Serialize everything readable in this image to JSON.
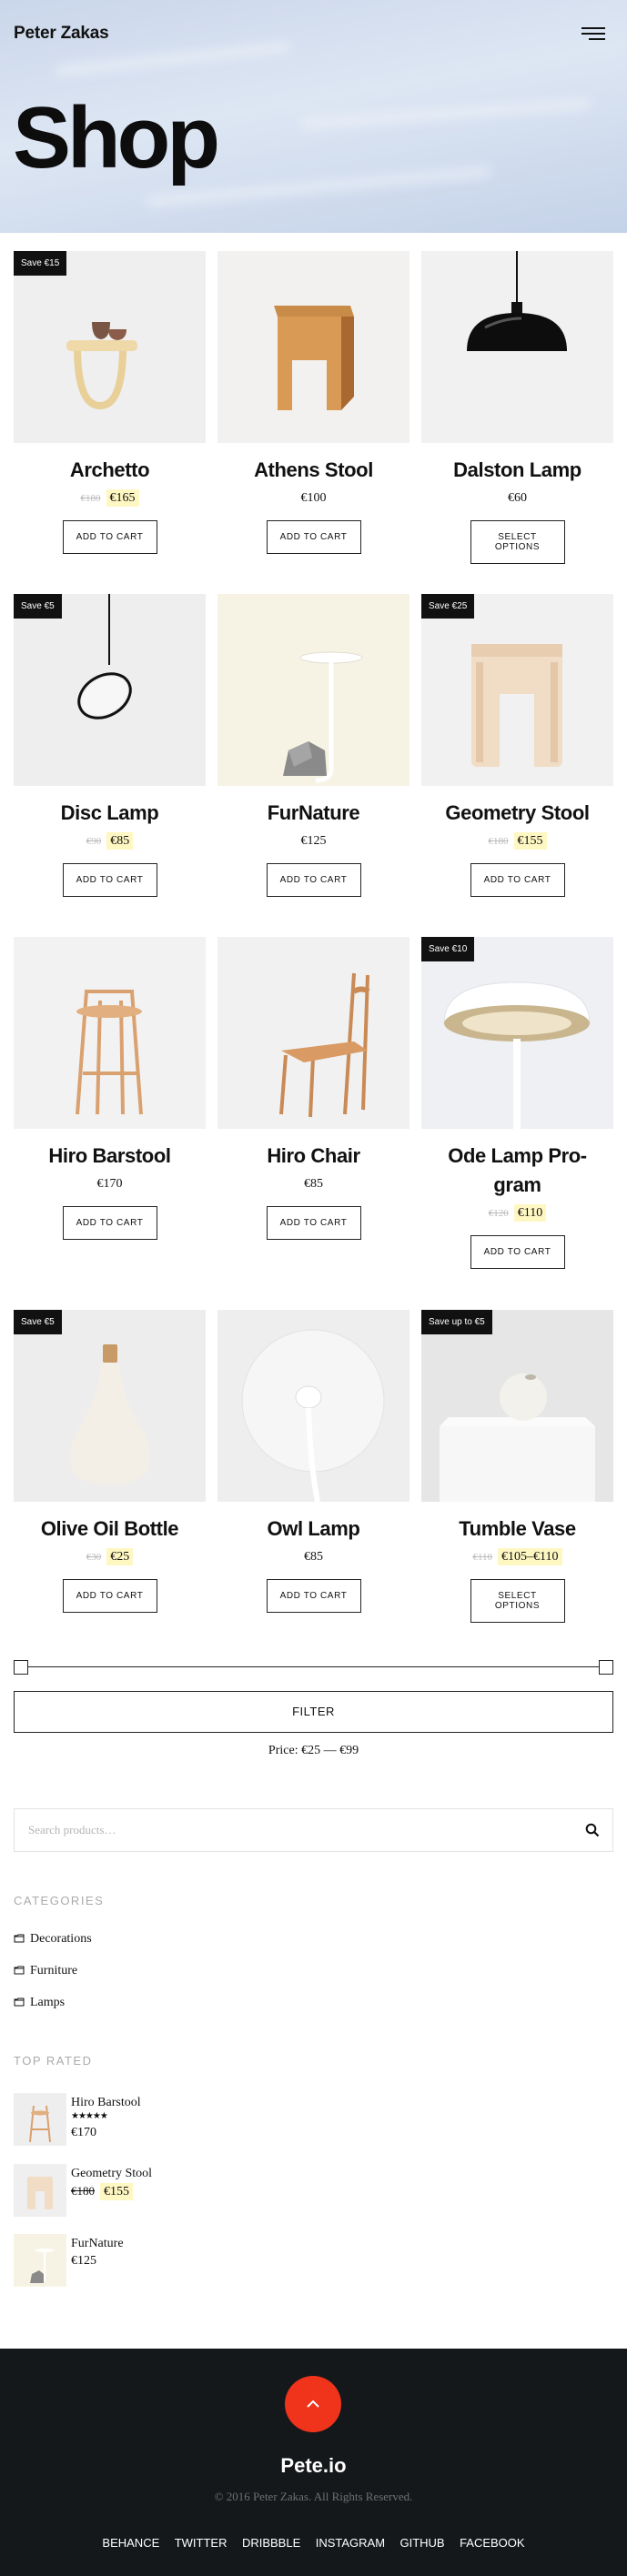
{
  "header": {
    "brand": "Peter Zakas",
    "title": "Shop"
  },
  "products": [
    {
      "name": "Archetto",
      "badge": "Save €15",
      "old_price": "€180",
      "price": "€165",
      "button": "ADD TO CART"
    },
    {
      "name": "Athens Stool",
      "badge": "",
      "old_price": "",
      "price": "€100",
      "button": "ADD TO CART"
    },
    {
      "name": "Dalston Lamp",
      "badge": "",
      "old_price": "",
      "price": "€60",
      "button": "SELECT OPTIONS"
    },
    {
      "name": "Disc Lamp",
      "badge": "Save €5",
      "old_price": "€90",
      "price": "€85",
      "button": "ADD TO CART"
    },
    {
      "name": "FurNature",
      "badge": "",
      "old_price": "",
      "price": "€125",
      "button": "ADD TO CART"
    },
    {
      "name": "Geometry Stool",
      "badge": "Save €25",
      "old_price": "€180",
      "price": "€155",
      "button": "ADD TO CART"
    },
    {
      "name": "Hiro Barstool",
      "badge": "",
      "old_price": "",
      "price": "€170",
      "button": "ADD TO CART"
    },
    {
      "name": "Hiro Chair",
      "badge": "",
      "old_price": "",
      "price": "€85",
      "button": "ADD TO CART"
    },
    {
      "name_line1": "Ode Lamp Pro-",
      "name_line2": "gram",
      "badge": "Save €10",
      "old_price": "€120",
      "price": "€110",
      "button": "ADD TO CART"
    },
    {
      "name": "Olive Oil Bottle",
      "badge": "Save €5",
      "old_price": "€30",
      "price": "€25",
      "button": "ADD TO CART"
    },
    {
      "name": "Owl Lamp",
      "badge": "",
      "old_price": "",
      "price": "€85",
      "button": "ADD TO CART"
    },
    {
      "name": "Tumble Vase",
      "badge": "Save up to €5",
      "old_price": "€110",
      "price": "€105–€110",
      "button": "SELECT OPTIONS"
    }
  ],
  "price_filter": {
    "button": "FILTER",
    "label": "Price:",
    "range": "€25 — €99"
  },
  "search": {
    "placeholder": "Search products…"
  },
  "categories": {
    "title": "CATEGORIES",
    "items": [
      "Decorations",
      "Furniture",
      "Lamps"
    ]
  },
  "top_rated": {
    "title": "TOP RATED",
    "items": [
      {
        "name": "Hiro Barstool",
        "stars": "★★★★★",
        "rating": 5,
        "price": "€170"
      },
      {
        "name": "Geometry Stool",
        "old_price": "€180",
        "price": "€155"
      },
      {
        "name": "FurNature",
        "price": "€125"
      }
    ]
  },
  "footer": {
    "brand": "Pete.io",
    "copyright": "© 2016 Peter Zakas. All Rights Reserved.",
    "social": [
      "BEHANCE",
      "TWITTER",
      "DRIBBBLE",
      "INSTAGRAM",
      "GITHUB",
      "FACEBOOK"
    ],
    "accent": "#f0341b"
  }
}
